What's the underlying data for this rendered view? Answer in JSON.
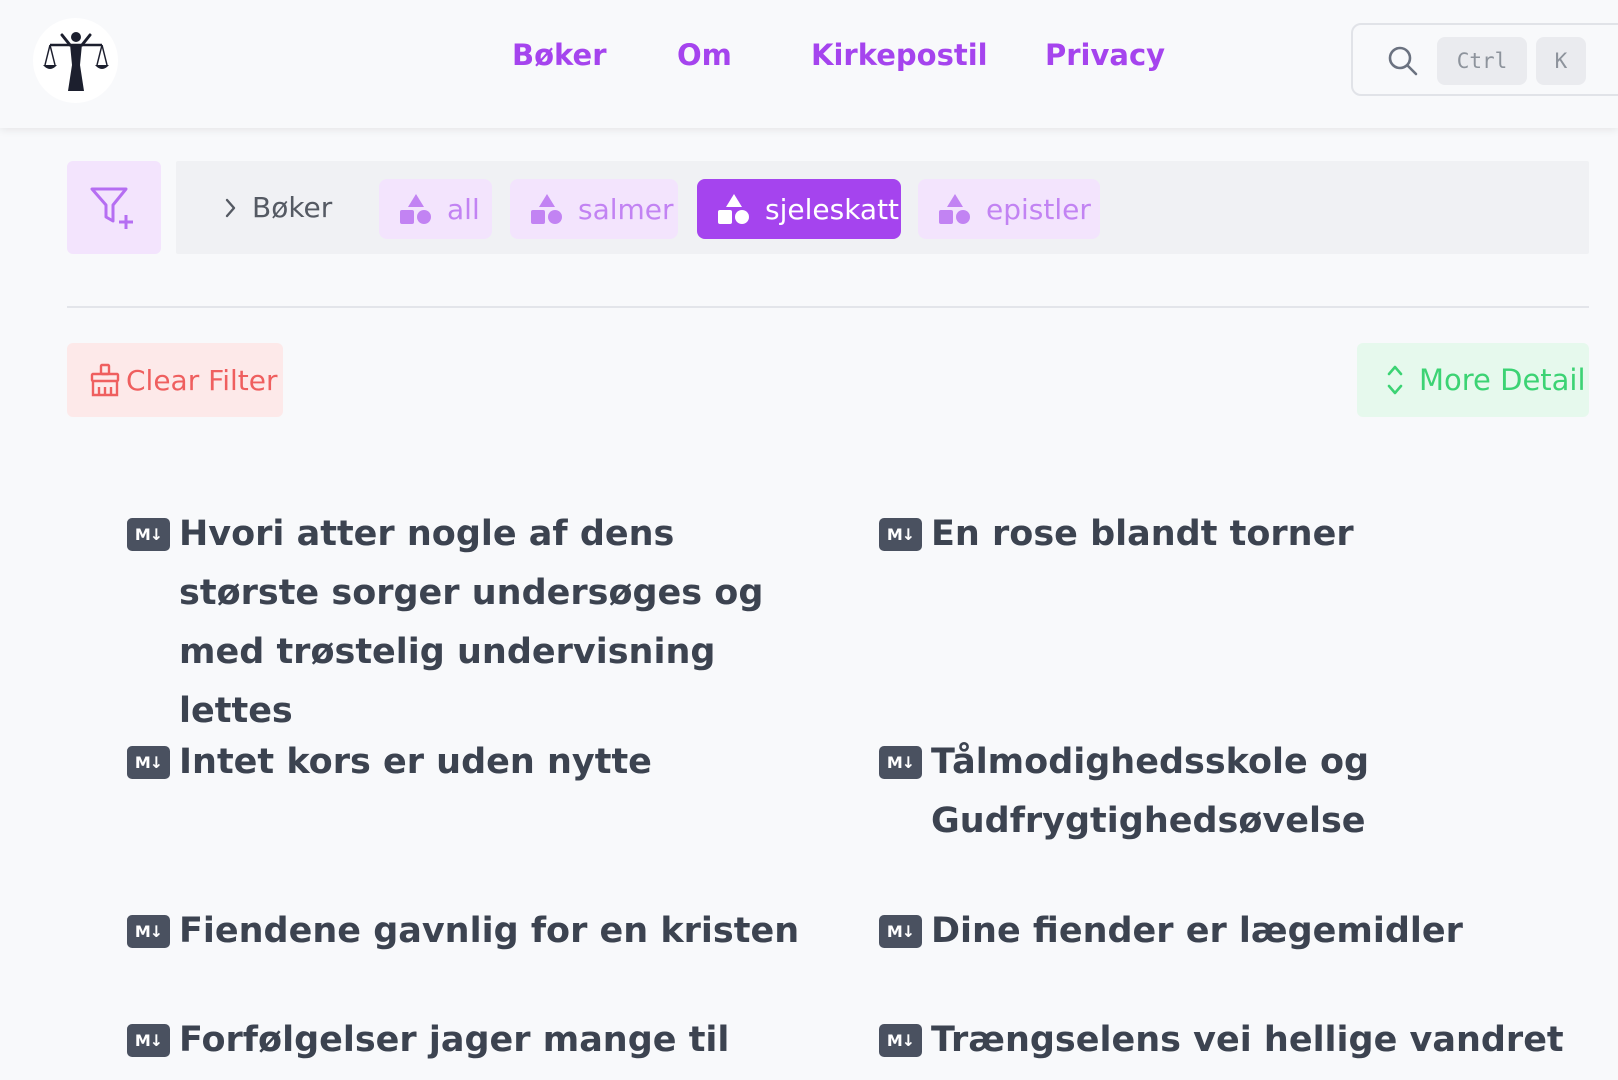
{
  "header": {
    "nav": [
      "Bøker",
      "Om",
      "Kirkepostil",
      "Privacy"
    ],
    "search": {
      "keys": [
        "Ctrl",
        "K"
      ]
    }
  },
  "breadcrumb": {
    "label": "Bøker"
  },
  "tags": [
    {
      "label": "all",
      "active": false
    },
    {
      "label": "salmer",
      "active": false
    },
    {
      "label": "sjeleskatt",
      "active": true
    },
    {
      "label": "epistler",
      "active": false
    }
  ],
  "actions": {
    "clear_filter": "Clear Filter",
    "more_detail": "More Detail"
  },
  "items": [
    "Hvori atter nogle af dens største sorger undersøges og med trøstelig undervisning lettes",
    "En rose blandt torner",
    "Intet kors er uden nytte",
    "Tålmodighedsskole og Gudfrygtighedsøvelse",
    "Fiendene gavnlig for en kristen",
    "Dine fiender er lægemidler",
    "Forfølgelser jager mange til",
    "Trængselens vei hellige vandret"
  ],
  "md_badge": "M↓",
  "colors": {
    "accent": "#a544ee",
    "danger": "#ef5f5f",
    "success": "#3cd374"
  }
}
